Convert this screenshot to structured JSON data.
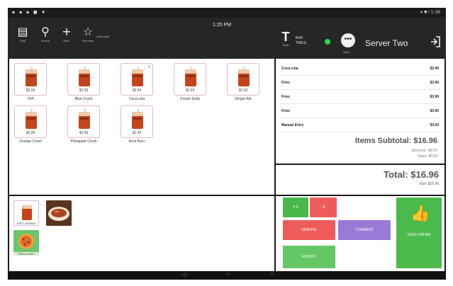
{
  "status_bar": {
    "left_icons": "▪ ▪ ▪ ■ ♦",
    "right_icons": "▾ ▼ ⁄ 1:36"
  },
  "header": {
    "clock": "1:25 PM",
    "toolbar": {
      "menu_caption": "Dept",
      "search_caption": "Search",
      "add_caption": "Misc.",
      "fav_caption": "Favorites",
      "fav_side_caption": "Unfavorite"
    },
    "table": {
      "caption": "Table",
      "label_line1": "BAR",
      "label_line2": "TABLE"
    },
    "more_caption": "More",
    "server_name": "Server Two"
  },
  "products": [
    {
      "name": "7UP",
      "price": "$2.99",
      "badge": ""
    },
    {
      "name": "Blue Crush",
      "price": "$2.99",
      "badge": ""
    },
    {
      "name": "Coca cola",
      "price": "$2.99",
      "badge": "1"
    },
    {
      "name": "Cream Soda",
      "price": "$2.99",
      "badge": ""
    },
    {
      "name": "Ginger Ale",
      "price": "$2.99",
      "badge": ""
    },
    {
      "name": "Orange Crush",
      "price": "$2.99",
      "badge": ""
    },
    {
      "name": "Pineapple Crush",
      "price": "$2.99",
      "badge": ""
    },
    {
      "name": "Root Beer",
      "price": "$1.99",
      "badge": ""
    }
  ],
  "favorites": [
    {
      "caption": "SOFT DRINKS"
    },
    {
      "caption": ""
    },
    {
      "caption": "Pizza Lovers"
    }
  ],
  "order": {
    "items": [
      {
        "name": "Coca cola",
        "price": "$2.99"
      },
      {
        "name": "Fries",
        "price": "$3.99"
      },
      {
        "name": "Fries",
        "price": "$3.99"
      },
      {
        "name": "Fries",
        "price": "$3.99"
      },
      {
        "name": "Manual Entry",
        "price": "$3.00"
      }
    ],
    "subtotal": "Items Subtotal: $16.96",
    "discount": "Discount: -$0.00",
    "taxes": "Taxes: $0.00",
    "total": "Total: $16.96",
    "due": "Due: $16.96"
  },
  "actions": {
    "plus": "+1",
    "minus": "-1",
    "remove": "REMOVE",
    "comment": "COMMENT",
    "modify": "MODIFY",
    "send_order": "SEND ORDER"
  },
  "colors": {
    "accent_green": "#4cba4c",
    "remove_red": "#ee5b5b",
    "comment_purple": "#9b79d6",
    "status_dot": "#2fd24a"
  }
}
